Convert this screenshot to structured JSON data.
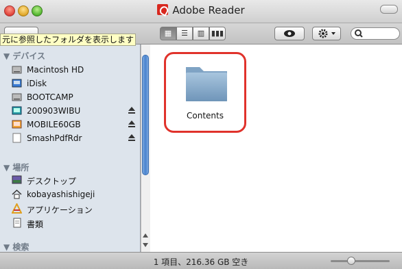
{
  "window": {
    "title": "Adobe Reader"
  },
  "toolbar": {
    "tooltip": "元に参照したフォルダを表示します",
    "view_modes": [
      "icon-view",
      "list-view",
      "column-view",
      "coverflow-view"
    ],
    "active_view": "icon-view"
  },
  "sidebar": {
    "sections": [
      {
        "header": "▼ デバイス",
        "items": [
          {
            "label": "Macintosh HD",
            "icon": "hard-drive-icon",
            "eject": false
          },
          {
            "label": "iDisk",
            "icon": "idisk-icon",
            "eject": false
          },
          {
            "label": "BOOTCAMP",
            "icon": "hard-drive-icon",
            "eject": false
          },
          {
            "label": "200903WIBU",
            "icon": "disk-image-icon",
            "eject": true
          },
          {
            "label": "MOBILE60GB",
            "icon": "external-drive-icon",
            "eject": true
          },
          {
            "label": "SmashPdfRdr",
            "icon": "volume-icon",
            "eject": true
          }
        ]
      },
      {
        "header": "▼ 場所",
        "items": [
          {
            "label": "デスクトップ",
            "icon": "desktop-icon",
            "eject": false
          },
          {
            "label": "kobayashishigeji",
            "icon": "home-icon",
            "eject": false
          },
          {
            "label": "アプリケーション",
            "icon": "applications-icon",
            "eject": false
          },
          {
            "label": "書類",
            "icon": "documents-icon",
            "eject": false
          }
        ]
      },
      {
        "header": "▼ 検索",
        "items": []
      }
    ]
  },
  "content": {
    "items": [
      {
        "label": "Contents",
        "icon": "folder-icon",
        "highlighted": true
      }
    ]
  },
  "status": {
    "text": "1 項目、216.36 GB 空き"
  },
  "colors": {
    "highlight": "#e0322b",
    "sidebar_bg": "#dde4ec"
  }
}
